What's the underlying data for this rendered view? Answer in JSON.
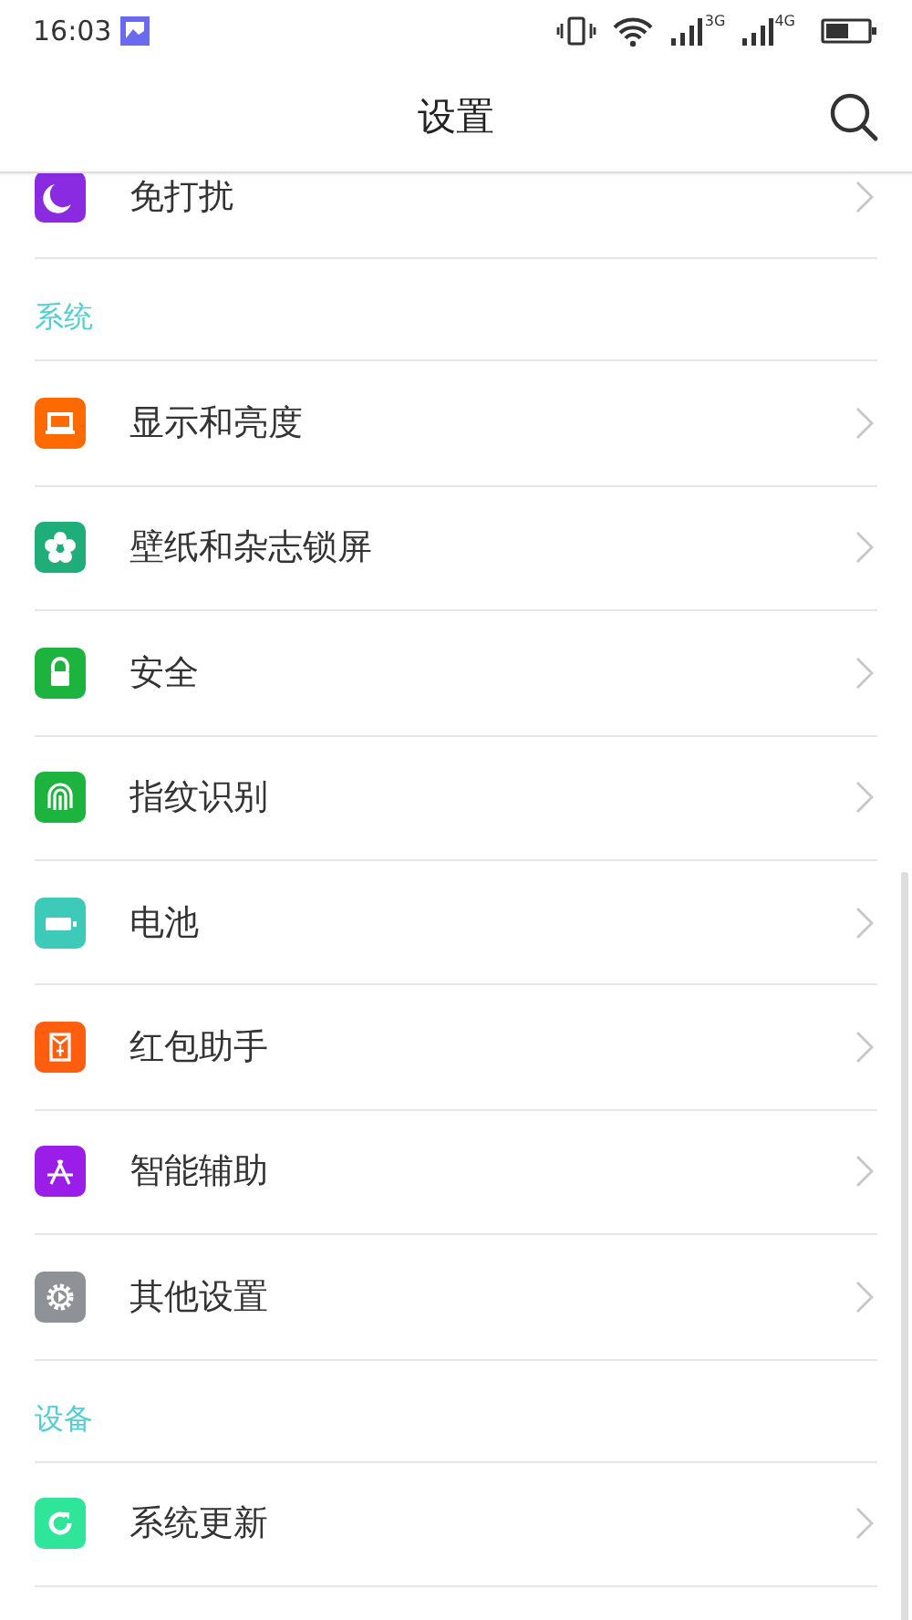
{
  "status_bar": {
    "time": "16:03",
    "network_1": "3G",
    "network_2": "4G"
  },
  "header": {
    "title": "设置"
  },
  "partial_item": {
    "label": "免打扰",
    "color": "#8a2be2"
  },
  "sections": [
    {
      "title": "系统",
      "items": [
        {
          "label": "显示和亮度",
          "color": "#ff6a00"
        },
        {
          "label": "壁纸和杂志锁屏",
          "color": "#1fae7a"
        },
        {
          "label": "安全",
          "color": "#1db33f"
        },
        {
          "label": "指纹识别",
          "color": "#1db33f"
        },
        {
          "label": "电池",
          "color": "#3ecab8"
        },
        {
          "label": "红包助手",
          "color": "#ff5e0e"
        },
        {
          "label": "智能辅助",
          "color": "#9b1ee8"
        },
        {
          "label": "其他设置",
          "color": "#8e9196"
        }
      ]
    },
    {
      "title": "设备",
      "items": [
        {
          "label": "系统更新",
          "color": "#2ee59a"
        }
      ]
    }
  ]
}
